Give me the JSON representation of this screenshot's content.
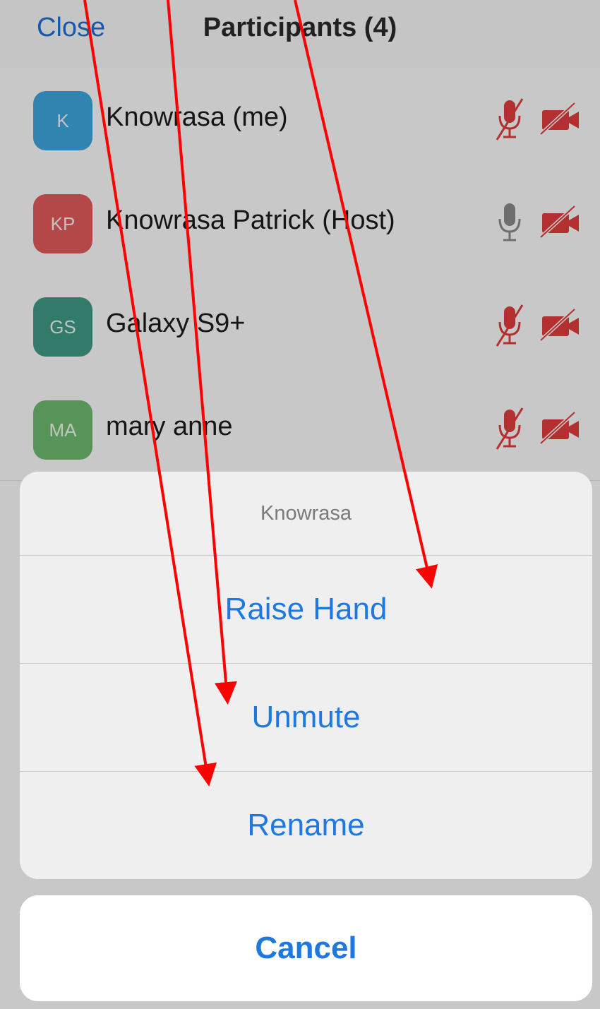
{
  "header": {
    "close_label": "Close",
    "title": "Participants (4)"
  },
  "participants": [
    {
      "initials": "K",
      "name": "Knowrasa (me)",
      "avatar_color": "#3fa6dd",
      "mic": "muted",
      "video": "off"
    },
    {
      "initials": "KP",
      "name": "Knowrasa Patrick (Host)",
      "avatar_color": "#e25959",
      "mic": "on",
      "video": "off"
    },
    {
      "initials": "GS",
      "name": "Galaxy S9+",
      "avatar_color": "#3f9a86",
      "mic": "muted",
      "video": "off"
    },
    {
      "initials": "MA",
      "name": "mary anne",
      "avatar_color": "#6dba6d",
      "mic": "muted",
      "video": "off"
    }
  ],
  "action_sheet": {
    "title": "Knowrasa",
    "items": [
      "Raise Hand",
      "Unmute",
      "Rename"
    ],
    "cancel_label": "Cancel"
  },
  "colors": {
    "accent": "#1f78e0",
    "muted_red": "#e23b3b",
    "mic_gray": "#8a8a8a",
    "annotation_red": "#ff0000"
  },
  "icons": [
    "microphone-muted-icon",
    "microphone-icon",
    "video-off-icon"
  ]
}
